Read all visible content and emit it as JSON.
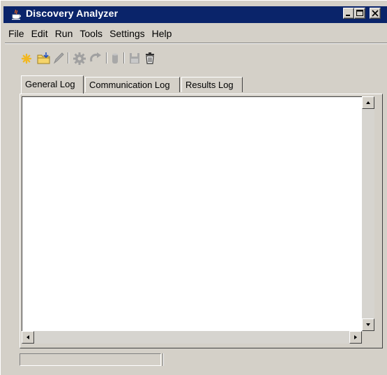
{
  "window": {
    "title": "Discovery Analyzer"
  },
  "menu": [
    "File",
    "Edit",
    "Run",
    "Tools",
    "Settings",
    "Help"
  ],
  "toolbar": {
    "buttons": [
      {
        "icon": "new-icon",
        "enabled": true
      },
      {
        "icon": "open-icon",
        "enabled": true
      },
      {
        "icon": "edit-icon",
        "enabled": false
      },
      {
        "icon": "gear-icon",
        "enabled": false
      },
      {
        "icon": "refresh-icon",
        "enabled": false
      },
      {
        "icon": "database-icon",
        "enabled": false
      },
      {
        "icon": "save-icon",
        "enabled": false
      },
      {
        "icon": "trash-icon",
        "enabled": true
      }
    ]
  },
  "tabs": [
    {
      "label": "General Log",
      "selected": true
    },
    {
      "label": "Communication Log",
      "selected": false
    },
    {
      "label": "Results Log",
      "selected": false
    }
  ],
  "log": {
    "text": ""
  },
  "status": {
    "text": ""
  },
  "colors": {
    "title_bar": "#0a246a",
    "window_bg": "#d4d0c8",
    "accent_new": "#f2b822"
  }
}
